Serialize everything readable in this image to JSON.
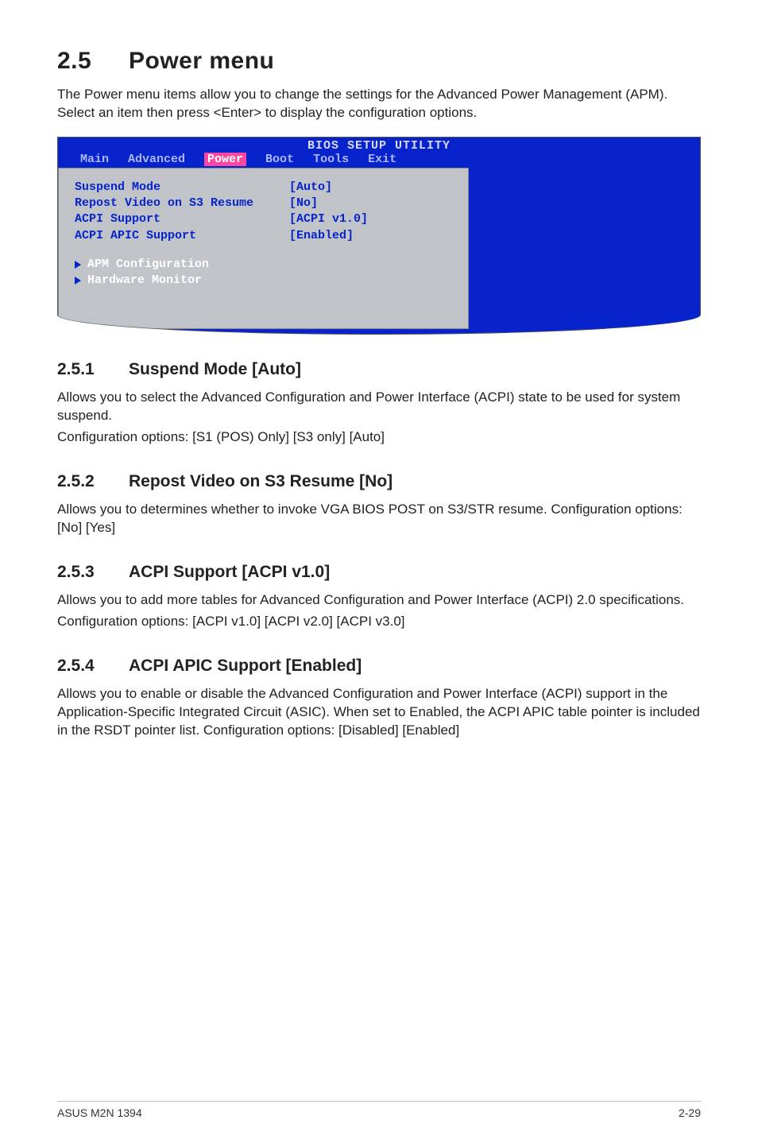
{
  "heading": {
    "number": "2.5",
    "title": "Power menu"
  },
  "intro": "The Power menu items allow you to change the settings for the Advanced Power Management (APM). Select an item then press <Enter> to display the configuration options.",
  "bios": {
    "title": "BIOS SETUP UTILITY",
    "menus": [
      "Main",
      "Advanced",
      "Power",
      "Boot",
      "Tools",
      "Exit"
    ],
    "active_menu_index": 2,
    "rows": [
      {
        "label": "Suspend Mode",
        "value": "[Auto]"
      },
      {
        "label": "Repost Video on S3 Resume",
        "value": "[No]"
      },
      {
        "label": "ACPI Support",
        "value": "[ACPI v1.0]"
      },
      {
        "label": "ACPI APIC Support",
        "value": "[Enabled]"
      }
    ],
    "submenus": [
      "APM Configuration",
      "Hardware Monitor"
    ]
  },
  "subsections": [
    {
      "num": "2.5.1",
      "title": "Suspend Mode [Auto]",
      "para1": "Allows you to select the Advanced Configuration and Power Interface (ACPI) state to be used for system suspend.",
      "para2": "Configuration options: [S1 (POS) Only] [S3 only] [Auto]"
    },
    {
      "num": "2.5.2",
      "title": "Repost Video on S3 Resume [No]",
      "para1": "Allows you to determines whether to invoke VGA BIOS POST on S3/STR resume. Configuration options: [No] [Yes]",
      "para2": ""
    },
    {
      "num": "2.5.3",
      "title": "ACPI Support [ACPI v1.0]",
      "para1": "Allows you to add more tables for Advanced Configuration and Power Interface (ACPI) 2.0 specifications.",
      "para2": "Configuration options: [ACPI v1.0] [ACPI v2.0] [ACPI v3.0]"
    },
    {
      "num": "2.5.4",
      "title": "ACPI APIC Support [Enabled]",
      "para1": "Allows you to enable or disable the Advanced Configuration and Power Interface (ACPI) support in the Application-Specific Integrated Circuit (ASIC). When set to Enabled, the ACPI APIC table pointer is included in the RSDT pointer list. Configuration options: [Disabled] [Enabled]",
      "para2": ""
    }
  ],
  "footer": {
    "left": "ASUS M2N 1394",
    "right": "2-29"
  }
}
